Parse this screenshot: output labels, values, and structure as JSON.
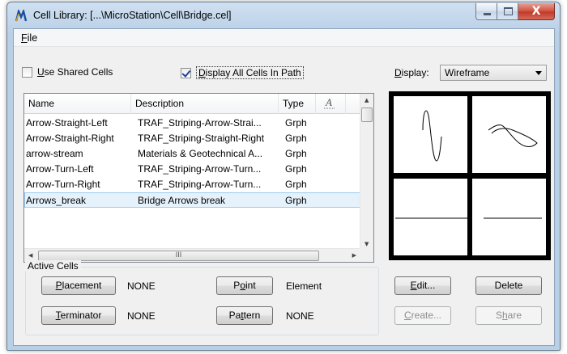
{
  "window": {
    "title": "Cell Library: [...\\MicroStation\\Cell\\Bridge.cel]",
    "close_glyph": "X"
  },
  "menu": {
    "file": {
      "accel": "F",
      "rest": "ile"
    }
  },
  "options": {
    "use_shared": {
      "accel": "U",
      "rest": "se Shared Cells",
      "checked": false
    },
    "display_all": {
      "accel": "D",
      "rest": "isplay All Cells In Path",
      "checked": true
    }
  },
  "display": {
    "label_accel": "D",
    "label_rest": "isplay:",
    "value": "Wireframe"
  },
  "list": {
    "columns": {
      "name": "Name",
      "description": "Description",
      "type": "Type"
    },
    "rows": [
      {
        "name": "Arrow-Straight-Left",
        "description": "TRAF_Striping-Arrow-Strai...",
        "type": "Grph"
      },
      {
        "name": "Arrow-Straight-Right",
        "description": "TRAF_Striping-Straight-Right",
        "type": "Grph"
      },
      {
        "name": "arrow-stream",
        "description": "Materials & Geotechnical A...",
        "type": "Grph"
      },
      {
        "name": "Arrow-Turn-Left",
        "description": "TRAF_Striping-Arrow-Turn...",
        "type": "Grph"
      },
      {
        "name": "Arrow-Turn-Right",
        "description": "TRAF_Striping-Arrow-Turn...",
        "type": "Grph"
      },
      {
        "name": "Arrows_break",
        "description": "Bridge Arrows break",
        "type": "Grph"
      }
    ],
    "hscroll_grip": "III"
  },
  "active_cells": {
    "label": "Active Cells",
    "placement": {
      "accel": "P",
      "rest": "lacement",
      "value": "NONE"
    },
    "point": {
      "pre": "P",
      "accel": "o",
      "rest": "int",
      "value": "Element"
    },
    "terminator": {
      "accel": "T",
      "rest": "erminator",
      "value": "NONE"
    },
    "pattern": {
      "pre": "Pa",
      "accel": "t",
      "rest": "tern",
      "value": "NONE"
    }
  },
  "buttons": {
    "edit": {
      "accel": "E",
      "rest": "dit..."
    },
    "delete": "Delete",
    "create": {
      "accel": "C",
      "rest": "reate..."
    },
    "share": {
      "pre": "S",
      "accel": "h",
      "rest": "are"
    }
  },
  "colors": {
    "selection": "#e6f2fb",
    "close": "#c23a2a",
    "text_icon": "#cc2200"
  },
  "icons": [
    "microstation-app-icon",
    "text-cell-icon"
  ]
}
